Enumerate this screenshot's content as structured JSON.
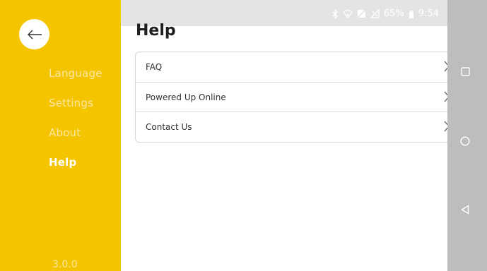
{
  "page": {
    "title": "Help"
  },
  "sidebar": {
    "items": [
      {
        "label": "Language",
        "active": false
      },
      {
        "label": "Settings",
        "active": false
      },
      {
        "label": "About",
        "active": false
      },
      {
        "label": "Help",
        "active": true
      }
    ],
    "version": "3.0.0"
  },
  "help_items": [
    {
      "label": "FAQ"
    },
    {
      "label": "Powered Up Online"
    },
    {
      "label": "Contact Us"
    }
  ],
  "status_bar": {
    "battery": "65%",
    "time": "9:54"
  },
  "colors": {
    "sidebar": "#F5C400",
    "background": "#FFFFFF",
    "navbar": "#BDBDBD"
  },
  "icons": {
    "back": "arrow-left-icon",
    "chevron": "chevron-right-icon",
    "nav_recent": "square-icon",
    "nav_home": "circle-icon",
    "nav_back": "triangle-back-icon"
  }
}
